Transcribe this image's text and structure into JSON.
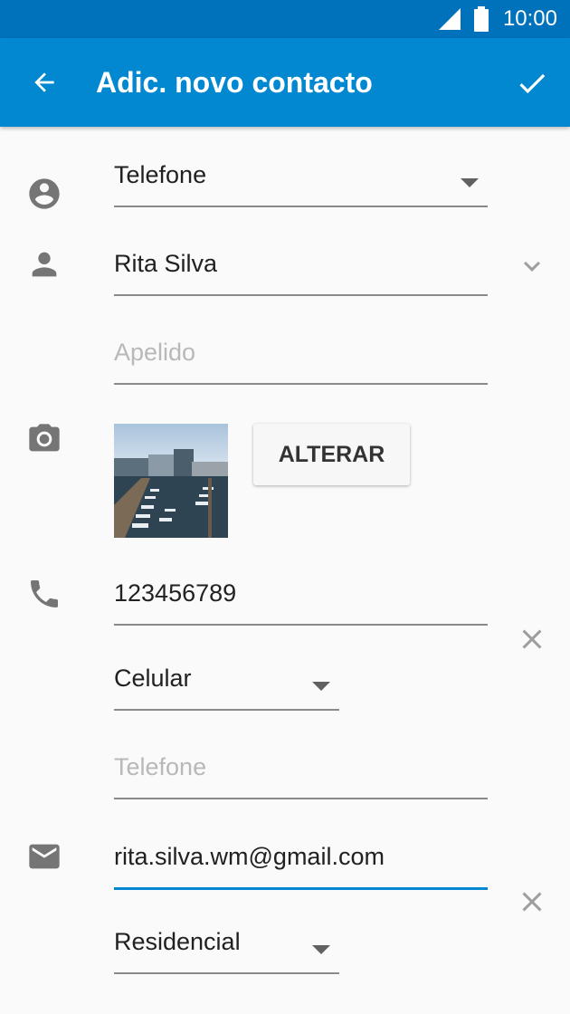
{
  "status_bar": {
    "time": "10:00",
    "icons": [
      "signal-icon",
      "battery-icon"
    ]
  },
  "app_bar": {
    "title": "Adic. novo contacto",
    "back_icon": "arrow-back-icon",
    "save_icon": "check-icon"
  },
  "form": {
    "account": {
      "value": "Telefone"
    },
    "name": {
      "value": "Rita Silva"
    },
    "surname": {
      "placeholder": "Apelido"
    },
    "photo": {
      "change_label": "ALTERAR"
    },
    "phone": {
      "value": "123456789",
      "type": "Celular",
      "new_placeholder": "Telefone"
    },
    "email": {
      "value": "rita.silva.wm@gmail.com",
      "type": "Residencial"
    }
  },
  "colors": {
    "status_bar": "#0072bc",
    "app_bar": "#0288d1",
    "accent": "#0288d1",
    "background": "#fafafa"
  }
}
